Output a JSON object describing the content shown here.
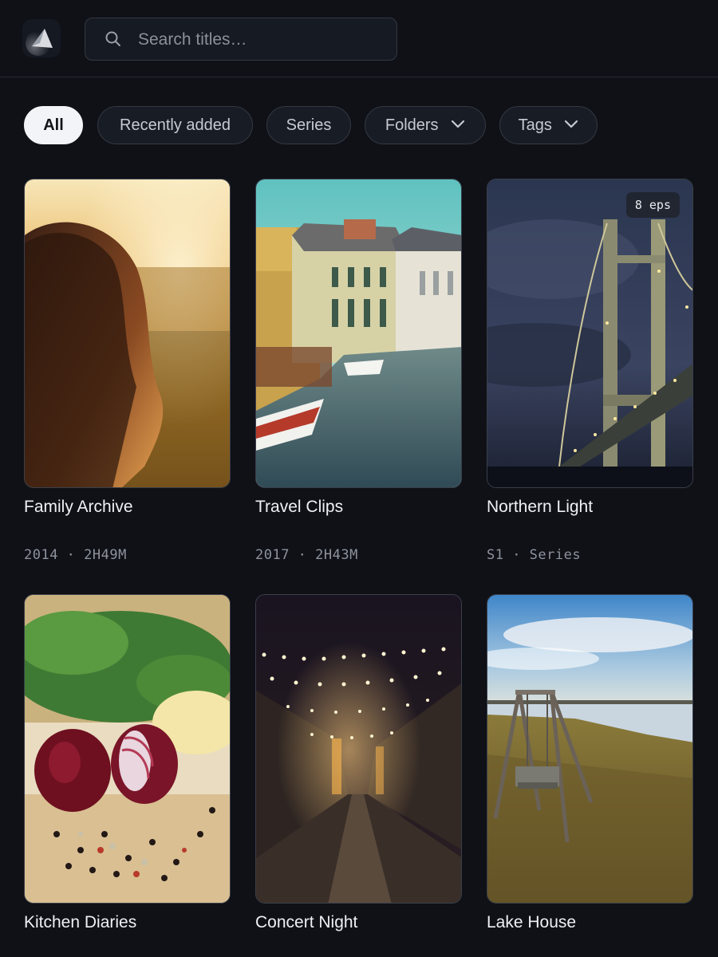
{
  "search": {
    "placeholder": "Search titles…",
    "value": ""
  },
  "filters": [
    {
      "label": "All",
      "active": true
    },
    {
      "label": "Recently added",
      "active": false
    },
    {
      "label": "Series",
      "active": false
    },
    {
      "label": "Folders",
      "active": false,
      "dropdown": true
    },
    {
      "label": "Tags",
      "active": false,
      "dropdown": true
    }
  ],
  "cards": [
    {
      "title": "Family Archive",
      "meta": "2014 · 2H49M",
      "badge": ""
    },
    {
      "title": "Travel Clips",
      "meta": "2017 · 2H43M",
      "badge": ""
    },
    {
      "title": "Northern Light",
      "meta": "S1 · Series",
      "badge": "8 eps"
    },
    {
      "title": "Kitchen Diaries",
      "meta": "",
      "badge": ""
    },
    {
      "title": "Concert Night",
      "meta": "",
      "badge": ""
    },
    {
      "title": "Lake House",
      "meta": "",
      "badge": ""
    }
  ],
  "icons": {
    "logo": "app-logo-icon",
    "search": "search-icon",
    "chevron": "chevron-down-icon"
  },
  "colors": {
    "background": "#0f1117",
    "chip_active_bg": "#f3f4f7",
    "chip_bg": "#181c24",
    "muted_text": "#8d929c"
  }
}
